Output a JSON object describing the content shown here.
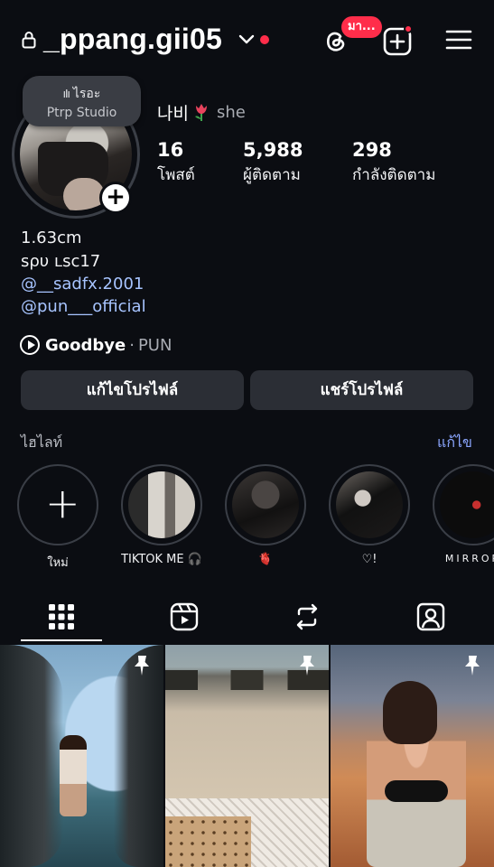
{
  "header": {
    "username": "_ppang.gii05",
    "threads_badge": "มา...",
    "lock_icon": "lock-icon",
    "threads_icon": "threads-icon",
    "create_icon": "plus-square-icon",
    "menu_icon": "menu-icon"
  },
  "note": {
    "title": "ไรอะ",
    "subtitle": "Ptrp Studio"
  },
  "profile": {
    "display_name": "나비",
    "pronoun": "she",
    "stats": [
      {
        "value": "16",
        "label": "โพสต์"
      },
      {
        "value": "5,988",
        "label": "ผู้ติดตาม"
      },
      {
        "value": "298",
        "label": "กำลังติดตาม"
      }
    ]
  },
  "bio": {
    "line1": "1.63cm",
    "line2": "ѕρυ ʟѕc17",
    "mention1": "@__sadfx.2001",
    "mention2": "@pun___official"
  },
  "music": {
    "title": "Goodbye",
    "separator": "·",
    "artist": "PUN"
  },
  "actions": {
    "edit_profile": "แก้ไขโปรไฟล์",
    "share_profile": "แชร์โปรไฟล์"
  },
  "highlights": {
    "title": "ไฮไลท์",
    "edit": "แก้ไข",
    "items": [
      {
        "label": "ใหม่"
      },
      {
        "label": "TIKTOK ME 🎧"
      },
      {
        "label": "🫀"
      },
      {
        "label": "♡!"
      },
      {
        "label": "MIRROR"
      }
    ]
  },
  "tabs": [
    "grid-icon",
    "reels-icon",
    "reposts-icon",
    "tagged-icon"
  ],
  "colors": {
    "background": "#0b0d12",
    "accent_red": "#ff2d4a",
    "link": "#a7c4ff",
    "button": "#2b2e35"
  }
}
